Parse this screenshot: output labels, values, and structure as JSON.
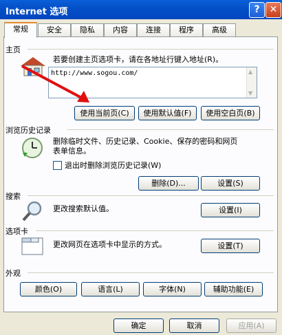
{
  "window": {
    "title": "Internet 选项",
    "help": "?",
    "close": "✕"
  },
  "tabs": [
    "常规",
    "安全",
    "隐私",
    "内容",
    "连接",
    "程序",
    "高级"
  ],
  "home": {
    "label": "主页",
    "desc": "若要创建主页选项卡，请在各地址行键入地址(R)。",
    "url": "http://www.sogou.com/",
    "btn_current": "使用当前页(C)",
    "btn_default": "使用默认值(F)",
    "btn_blank": "使用空白页(B)"
  },
  "history": {
    "label": "浏览历史记录",
    "desc_1": "删除临时文件、历史记录、Cookie、保存的密码和网页",
    "desc_2": "表单信息。",
    "checkbox": "退出时删除浏览历史记录(W)",
    "btn_delete": "删除(D)...",
    "btn_settings": "设置(S)"
  },
  "search": {
    "label": "搜索",
    "desc": "更改搜索默认值。",
    "btn_settings": "设置(I)"
  },
  "tabs_section": {
    "label": "选项卡",
    "desc": "更改网页在选项卡中显示的方式。",
    "btn_settings": "设置(T)"
  },
  "appearance": {
    "label": "外观",
    "btn_colors": "颜色(O)",
    "btn_languages": "语言(L)",
    "btn_fonts": "字体(N)",
    "btn_accessibility": "辅助功能(E)"
  },
  "footer": {
    "ok": "确定",
    "cancel": "取消",
    "apply": "应用(A)"
  }
}
